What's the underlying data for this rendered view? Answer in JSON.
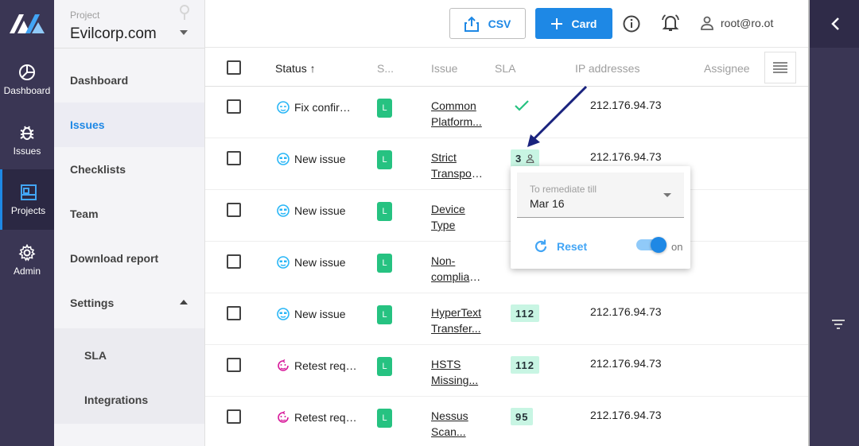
{
  "rail": {
    "items": [
      {
        "label": "Dashboard",
        "icon": "dashboard-icon"
      },
      {
        "label": "Issues",
        "icon": "bug-icon"
      },
      {
        "label": "Projects",
        "icon": "projects-icon"
      },
      {
        "label": "Admin",
        "icon": "gear-icon"
      }
    ],
    "active": "Projects"
  },
  "project": {
    "caption": "Project",
    "name": "Evilcorp.com"
  },
  "nav": {
    "items": [
      "Dashboard",
      "Issues",
      "Checklists",
      "Team",
      "Download report",
      "Settings"
    ],
    "active": "Issues",
    "sub_items": [
      "SLA",
      "Integrations"
    ]
  },
  "topbar": {
    "csv_label": "CSV",
    "card_label": "Card",
    "user": "root@ro.ot"
  },
  "table": {
    "headers": {
      "status": "Status ↑",
      "severity": "S...",
      "issue": "Issue",
      "sla": "SLA",
      "ip": "IP addresses",
      "assignee": "Assignee"
    },
    "rows": [
      {
        "status": "Fix confirmed",
        "status_icon": "fix-confirmed-icon",
        "severity": "L",
        "issue_line1": "Common",
        "issue_line2": "Platform...",
        "sla": "",
        "sla_check": true,
        "ip": "212.176.94.73"
      },
      {
        "status": "New issue",
        "status_icon": "new-issue-icon",
        "severity": "L",
        "issue_line1": "Strict",
        "issue_line2": "Transpor...",
        "sla": "3",
        "sla_user": true,
        "ip": "212.176.94.73"
      },
      {
        "status": "New issue",
        "status_icon": "new-issue-icon",
        "severity": "L",
        "issue_line1": "Device",
        "issue_line2": "Type",
        "sla": "",
        "ip": ""
      },
      {
        "status": "New issue",
        "status_icon": "new-issue-icon",
        "severity": "L",
        "issue_line1": "Non-",
        "issue_line2": "complian...",
        "sla": "",
        "ip": ""
      },
      {
        "status": "New issue",
        "status_icon": "new-issue-icon",
        "severity": "L",
        "issue_line1": "HyperText",
        "issue_line2": "Transfer...",
        "sla": "112",
        "ip": "212.176.94.73"
      },
      {
        "status": "Retest required",
        "status_icon": "retest-icon",
        "severity": "L",
        "issue_line1": "HSTS",
        "issue_line2": "Missing...",
        "sla": "112",
        "ip": "212.176.94.73"
      },
      {
        "status": "Retest required",
        "status_icon": "retest-icon",
        "severity": "L",
        "issue_line1": "Nessus",
        "issue_line2": "Scan...",
        "sla": "95",
        "ip": "212.176.94.73"
      }
    ]
  },
  "popup": {
    "field_label": "To remediate till",
    "field_value": "Mar 16",
    "reset_label": "Reset",
    "toggle_label": "on",
    "toggle_on": true
  },
  "colors": {
    "accent": "#1e88e5",
    "rail": "#3a3654",
    "severity_low": "#26c281",
    "sla_badge": "#c8f5e3"
  }
}
